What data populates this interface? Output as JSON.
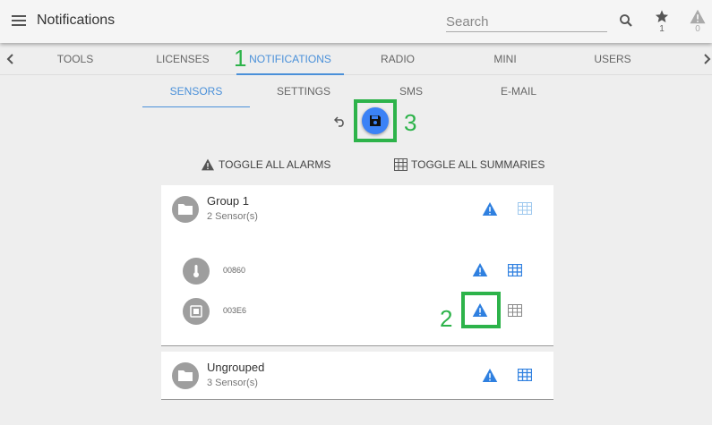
{
  "header": {
    "title": "Notifications",
    "search_placeholder": "Search",
    "favorites_count": "1",
    "alerts_count": "0"
  },
  "main_nav": {
    "tabs": [
      {
        "label": "TOOLS"
      },
      {
        "label": "LICENSES"
      },
      {
        "label": "NOTIFICATIONS",
        "active": true
      },
      {
        "label": "RADIO"
      },
      {
        "label": "MINI"
      },
      {
        "label": "USERS"
      }
    ]
  },
  "sub_nav": {
    "tabs": [
      {
        "label": "SENSORS",
        "active": true
      },
      {
        "label": "SETTINGS"
      },
      {
        "label": "SMS"
      },
      {
        "label": "E-MAIL"
      }
    ]
  },
  "toolbar": {
    "toggle_alarms_label": "TOGGLE ALL ALARMS",
    "toggle_summaries_label": "TOGGLE ALL SUMMARIES"
  },
  "annotations": {
    "one": "1",
    "two": "2",
    "three": "3"
  },
  "groups": [
    {
      "name": "Group 1",
      "count": "2 Sensor(s)",
      "sensors": [
        {
          "id": "00860",
          "icon": "thermometer-icon"
        },
        {
          "id": "003E6",
          "icon": "square-sensor-icon"
        }
      ]
    },
    {
      "name": "Ungrouped",
      "count": "3 Sensor(s)"
    }
  ],
  "colors": {
    "accent": "#4a90d9",
    "alarm_blue": "#3b82f6",
    "annotation_green": "#2db34a",
    "avatar_grey": "#9e9e9e"
  }
}
